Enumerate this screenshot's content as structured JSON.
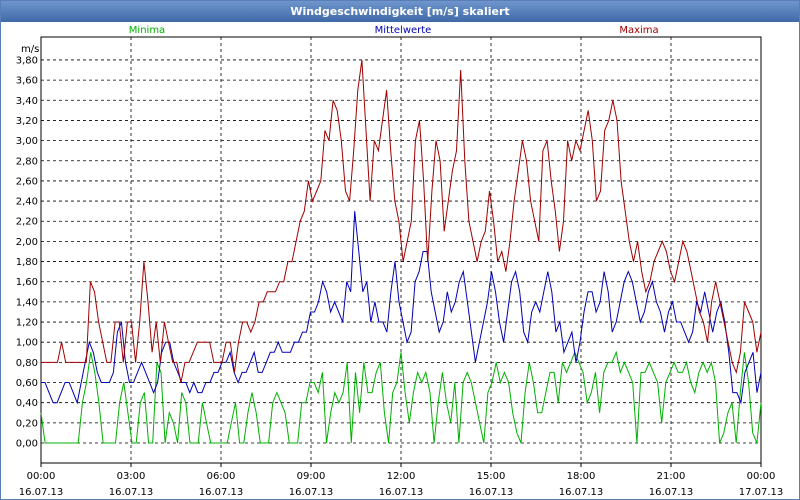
{
  "window": {
    "title": "Windgeschwindigkeit [m/s] skaliert"
  },
  "colors": {
    "frame": "#5a7fb8",
    "grid": "#000000",
    "minima": "#00b000",
    "mittelwerte": "#0000b4",
    "maxima": "#a00000"
  },
  "chart_data": {
    "type": "line",
    "title": "Windgeschwindigkeit [m/s] skaliert",
    "ylabel": "m/s",
    "ylim": [
      0,
      3.9
    ],
    "yticks": [
      "0,00",
      "0,20",
      "0,40",
      "0,60",
      "0,80",
      "1,00",
      "1,20",
      "1,40",
      "1,60",
      "1,80",
      "2,00",
      "2,20",
      "2,40",
      "2,60",
      "2,80",
      "3,00",
      "3,20",
      "3,40",
      "3,60",
      "3,80"
    ],
    "xticks": [
      {
        "time": "00:00",
        "date": "16.07.13"
      },
      {
        "time": "03:00",
        "date": "16.07.13"
      },
      {
        "time": "06:00",
        "date": "16.07.13"
      },
      {
        "time": "09:00",
        "date": "16.07.13"
      },
      {
        "time": "12:00",
        "date": "16.07.13"
      },
      {
        "time": "15:00",
        "date": "16.07.13"
      },
      {
        "time": "18:00",
        "date": "16.07.13"
      },
      {
        "time": "21:00",
        "date": "16.07.13"
      },
      {
        "time": "00:00",
        "date": "17.07.13"
      }
    ],
    "x_start": "16.07.13 00:00",
    "x_end": "17.07.13 00:00",
    "interval_minutes": 10,
    "grid": true,
    "legend_position": "top",
    "series": [
      {
        "name": "Minima",
        "color": "#00b000",
        "values": [
          0.3,
          0.0,
          0.0,
          0.0,
          0.0,
          0.0,
          0.0,
          0.0,
          0.0,
          0.0,
          0.4,
          0.6,
          0.9,
          0.7,
          0.4,
          0.0,
          0.0,
          0.0,
          0.0,
          0.4,
          0.6,
          0.3,
          0.0,
          0.0,
          0.4,
          0.5,
          0.0,
          0.0,
          0.8,
          0.7,
          0.0,
          0.3,
          0.2,
          0.0,
          0.5,
          0.4,
          0.0,
          0.0,
          0.0,
          0.4,
          0.2,
          0.0,
          0.0,
          0.0,
          0.0,
          0.0,
          0.2,
          0.4,
          0.0,
          0.0,
          0.3,
          0.5,
          0.3,
          0.0,
          0.0,
          0.0,
          0.4,
          0.5,
          0.4,
          0.3,
          0.0,
          0.0,
          0.0,
          0.4,
          0.4,
          0.6,
          0.6,
          0.5,
          0.7,
          0.0,
          0.3,
          0.5,
          0.4,
          0.5,
          0.8,
          0.0,
          0.7,
          0.3,
          0.8,
          0.5,
          0.5,
          0.7,
          0.8,
          0.3,
          0.0,
          0.5,
          0.6,
          0.9,
          0.5,
          0.2,
          0.5,
          0.7,
          0.6,
          0.7,
          0.5,
          0.0,
          0.4,
          0.7,
          0.4,
          0.2,
          0.6,
          0.0,
          0.6,
          0.7,
          0.6,
          0.4,
          0.2,
          0.0,
          0.5,
          0.6,
          0.8,
          0.6,
          0.7,
          0.6,
          0.3,
          0.1,
          0.0,
          0.5,
          0.8,
          0.6,
          0.3,
          0.3,
          0.5,
          0.7,
          0.7,
          0.4,
          0.8,
          0.7,
          0.8,
          0.9,
          0.8,
          0.7,
          0.4,
          0.5,
          0.7,
          0.3,
          0.7,
          0.8,
          0.8,
          0.9,
          0.7,
          0.8,
          0.7,
          0.6,
          0.0,
          0.7,
          0.7,
          0.8,
          0.7,
          0.6,
          0.2,
          0.6,
          0.7,
          0.8,
          0.7,
          0.7,
          0.8,
          0.6,
          0.5,
          0.7,
          0.8,
          0.7,
          0.8,
          0.6,
          0.0,
          0.1,
          0.3,
          0.4,
          0.0,
          0.5,
          0.9,
          0.6,
          0.1,
          0.0,
          0.4
        ]
      },
      {
        "name": "Mittelwerte",
        "color": "#0000b4",
        "values": [
          0.6,
          0.6,
          0.5,
          0.4,
          0.4,
          0.5,
          0.6,
          0.6,
          0.5,
          0.4,
          0.6,
          0.8,
          1.0,
          0.9,
          0.7,
          0.6,
          0.6,
          0.6,
          0.7,
          1.1,
          1.2,
          0.8,
          0.6,
          0.6,
          0.7,
          0.8,
          0.7,
          0.6,
          0.5,
          0.6,
          0.9,
          1.0,
          1.0,
          0.8,
          0.7,
          0.6,
          0.6,
          0.5,
          0.6,
          0.5,
          0.5,
          0.6,
          0.6,
          0.7,
          0.7,
          0.8,
          0.8,
          0.9,
          0.7,
          0.6,
          0.7,
          0.7,
          0.8,
          0.9,
          0.7,
          0.7,
          0.8,
          0.9,
          0.9,
          1.0,
          0.9,
          0.9,
          0.9,
          1.0,
          1.0,
          1.1,
          1.1,
          1.3,
          1.3,
          1.4,
          1.6,
          1.5,
          1.3,
          1.4,
          1.3,
          1.2,
          1.6,
          1.5,
          2.3,
          1.9,
          1.5,
          1.6,
          1.2,
          1.4,
          1.2,
          1.2,
          1.1,
          1.5,
          1.8,
          1.4,
          1.2,
          1.0,
          1.1,
          1.6,
          1.7,
          1.9,
          1.9,
          1.5,
          1.3,
          1.1,
          1.2,
          1.5,
          1.3,
          1.4,
          1.6,
          1.7,
          1.4,
          1.1,
          0.8,
          1.0,
          1.2,
          1.4,
          1.7,
          1.5,
          1.2,
          1.0,
          1.3,
          1.6,
          1.7,
          1.5,
          1.1,
          1.0,
          1.3,
          1.4,
          1.3,
          1.5,
          1.7,
          1.5,
          1.1,
          1.2,
          0.9,
          1.0,
          1.1,
          0.8,
          1.0,
          1.3,
          1.5,
          1.5,
          1.3,
          1.4,
          1.7,
          1.5,
          1.1,
          1.2,
          1.4,
          1.6,
          1.7,
          1.6,
          1.4,
          1.2,
          1.3,
          1.5,
          1.6,
          1.4,
          1.3,
          1.1,
          1.3,
          1.4,
          1.2,
          1.2,
          1.1,
          1.0,
          1.1,
          1.4,
          1.3,
          1.5,
          1.3,
          1.1,
          1.3,
          1.4,
          1.2,
          0.9,
          0.5,
          0.5,
          0.4,
          0.7,
          0.8,
          0.9,
          0.5,
          0.7
        ]
      },
      {
        "name": "Maxima",
        "color": "#a00000",
        "values": [
          0.8,
          0.8,
          0.8,
          0.8,
          0.8,
          1.0,
          0.8,
          0.8,
          0.8,
          0.8,
          0.8,
          0.8,
          1.6,
          1.5,
          1.2,
          1.0,
          0.8,
          0.8,
          1.2,
          1.2,
          0.8,
          1.2,
          1.2,
          0.8,
          1.2,
          1.8,
          1.4,
          0.9,
          1.2,
          0.8,
          1.2,
          1.0,
          0.8,
          0.8,
          0.6,
          0.8,
          0.8,
          0.9,
          1.0,
          1.0,
          1.0,
          1.0,
          0.8,
          0.8,
          0.8,
          1.0,
          1.0,
          0.7,
          1.0,
          1.2,
          1.2,
          1.1,
          1.2,
          1.4,
          1.4,
          1.5,
          1.5,
          1.5,
          1.6,
          1.6,
          1.8,
          1.8,
          2.0,
          2.2,
          2.3,
          2.6,
          2.4,
          2.5,
          2.6,
          3.1,
          3.0,
          3.4,
          3.3,
          3.0,
          2.5,
          2.4,
          2.9,
          3.5,
          3.8,
          3.1,
          2.4,
          3.0,
          2.9,
          3.2,
          3.5,
          2.9,
          2.4,
          2.2,
          1.8,
          2.0,
          2.2,
          3.0,
          3.2,
          2.6,
          1.8,
          2.5,
          3.0,
          2.8,
          2.1,
          2.4,
          2.7,
          2.9,
          3.7,
          2.8,
          2.2,
          2.0,
          1.8,
          2.0,
          2.1,
          2.5,
          2.2,
          1.8,
          1.9,
          1.7,
          2.0,
          2.4,
          2.7,
          3.0,
          2.8,
          2.4,
          2.2,
          2.0,
          2.9,
          3.0,
          2.6,
          2.3,
          1.9,
          2.2,
          3.0,
          2.8,
          3.0,
          2.9,
          3.1,
          3.3,
          3.0,
          2.4,
          2.5,
          3.1,
          3.2,
          3.4,
          3.2,
          2.6,
          2.3,
          2.0,
          1.8,
          2.0,
          1.7,
          1.5,
          1.6,
          1.8,
          1.9,
          2.0,
          1.9,
          1.7,
          1.6,
          1.8,
          2.0,
          1.9,
          1.7,
          1.5,
          1.3,
          1.2,
          1.0,
          1.4,
          1.6,
          1.4,
          1.2,
          1.0,
          0.8,
          0.7,
          0.9,
          1.4,
          1.3,
          1.2,
          0.9,
          1.1
        ]
      }
    ]
  }
}
